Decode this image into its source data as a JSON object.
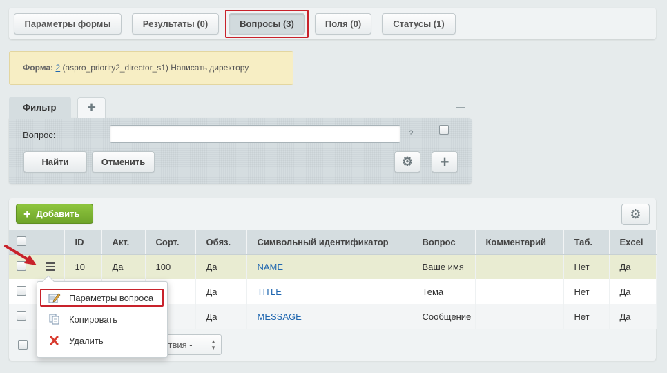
{
  "tabs": [
    {
      "label": "Параметры формы"
    },
    {
      "label": "Результаты (0)"
    },
    {
      "label": "Вопросы (3)"
    },
    {
      "label": "Поля (0)"
    },
    {
      "label": "Статусы (1)"
    }
  ],
  "form_note": {
    "label": "Форма:",
    "id_link": "2",
    "text": "(aspro_priority2_director_s1) Написать директору"
  },
  "filter": {
    "tab_label": "Фильтр",
    "add_tab_symbol": "+",
    "field_label": "Вопрос:",
    "field_value": "",
    "help_symbol": "?",
    "find_label": "Найти",
    "cancel_label": "Отменить"
  },
  "grid": {
    "add_label": "Добавить",
    "columns": [
      "ID",
      "Акт.",
      "Сорт.",
      "Обяз.",
      "Символьный идентификатор",
      "Вопрос",
      "Комментарий",
      "Таб.",
      "Excel"
    ],
    "rows": [
      {
        "id": "10",
        "active": "Да",
        "sort": "100",
        "required": "Да",
        "code": "NAME",
        "question": "Ваше имя",
        "comment": "",
        "tab": "Нет",
        "excel": "Да"
      },
      {
        "id": "",
        "active": "",
        "sort": "",
        "required": "Да",
        "code": "TITLE",
        "question": "Тема",
        "comment": "",
        "tab": "Нет",
        "excel": "Да"
      },
      {
        "id": "",
        "active": "",
        "sort": "",
        "required": "Да",
        "code": "MESSAGE",
        "question": "Сообщение",
        "comment": "",
        "tab": "Нет",
        "excel": "Да"
      }
    ],
    "action_select": "ствия -"
  },
  "context_menu": {
    "items": [
      {
        "label": "Параметры вопроса",
        "icon": "edit-icon"
      },
      {
        "label": "Копировать",
        "icon": "copy-icon"
      },
      {
        "label": "Удалить",
        "icon": "delete-icon"
      }
    ]
  },
  "colors": {
    "highlight": "#c8222b",
    "link": "#2067b0",
    "add_button": "#7cb733",
    "note_bg": "#f7eec4"
  }
}
